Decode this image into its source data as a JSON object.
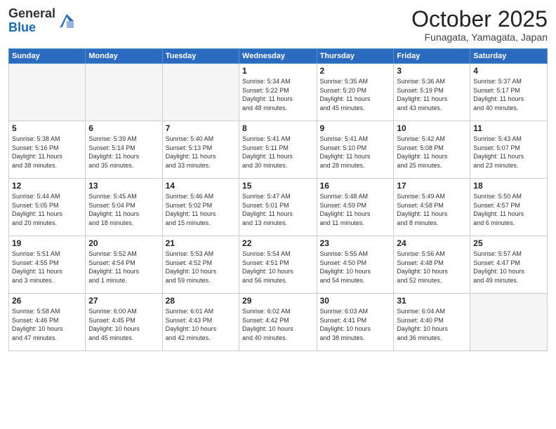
{
  "header": {
    "logo_general": "General",
    "logo_blue": "Blue",
    "month_title": "October 2025",
    "subtitle": "Funagata, Yamagata, Japan"
  },
  "weekdays": [
    "Sunday",
    "Monday",
    "Tuesday",
    "Wednesday",
    "Thursday",
    "Friday",
    "Saturday"
  ],
  "weeks": [
    [
      {
        "day": "",
        "info": ""
      },
      {
        "day": "",
        "info": ""
      },
      {
        "day": "",
        "info": ""
      },
      {
        "day": "1",
        "info": "Sunrise: 5:34 AM\nSunset: 5:22 PM\nDaylight: 11 hours\nand 48 minutes."
      },
      {
        "day": "2",
        "info": "Sunrise: 5:35 AM\nSunset: 5:20 PM\nDaylight: 11 hours\nand 45 minutes."
      },
      {
        "day": "3",
        "info": "Sunrise: 5:36 AM\nSunset: 5:19 PM\nDaylight: 11 hours\nand 43 minutes."
      },
      {
        "day": "4",
        "info": "Sunrise: 5:37 AM\nSunset: 5:17 PM\nDaylight: 11 hours\nand 40 minutes."
      }
    ],
    [
      {
        "day": "5",
        "info": "Sunrise: 5:38 AM\nSunset: 5:16 PM\nDaylight: 11 hours\nand 38 minutes."
      },
      {
        "day": "6",
        "info": "Sunrise: 5:39 AM\nSunset: 5:14 PM\nDaylight: 11 hours\nand 35 minutes."
      },
      {
        "day": "7",
        "info": "Sunrise: 5:40 AM\nSunset: 5:13 PM\nDaylight: 11 hours\nand 33 minutes."
      },
      {
        "day": "8",
        "info": "Sunrise: 5:41 AM\nSunset: 5:11 PM\nDaylight: 11 hours\nand 30 minutes."
      },
      {
        "day": "9",
        "info": "Sunrise: 5:41 AM\nSunset: 5:10 PM\nDaylight: 11 hours\nand 28 minutes."
      },
      {
        "day": "10",
        "info": "Sunrise: 5:42 AM\nSunset: 5:08 PM\nDaylight: 11 hours\nand 25 minutes."
      },
      {
        "day": "11",
        "info": "Sunrise: 5:43 AM\nSunset: 5:07 PM\nDaylight: 11 hours\nand 23 minutes."
      }
    ],
    [
      {
        "day": "12",
        "info": "Sunrise: 5:44 AM\nSunset: 5:05 PM\nDaylight: 11 hours\nand 20 minutes."
      },
      {
        "day": "13",
        "info": "Sunrise: 5:45 AM\nSunset: 5:04 PM\nDaylight: 11 hours\nand 18 minutes."
      },
      {
        "day": "14",
        "info": "Sunrise: 5:46 AM\nSunset: 5:02 PM\nDaylight: 11 hours\nand 15 minutes."
      },
      {
        "day": "15",
        "info": "Sunrise: 5:47 AM\nSunset: 5:01 PM\nDaylight: 11 hours\nand 13 minutes."
      },
      {
        "day": "16",
        "info": "Sunrise: 5:48 AM\nSunset: 4:59 PM\nDaylight: 11 hours\nand 11 minutes."
      },
      {
        "day": "17",
        "info": "Sunrise: 5:49 AM\nSunset: 4:58 PM\nDaylight: 11 hours\nand 8 minutes."
      },
      {
        "day": "18",
        "info": "Sunrise: 5:50 AM\nSunset: 4:57 PM\nDaylight: 11 hours\nand 6 minutes."
      }
    ],
    [
      {
        "day": "19",
        "info": "Sunrise: 5:51 AM\nSunset: 4:55 PM\nDaylight: 11 hours\nand 3 minutes."
      },
      {
        "day": "20",
        "info": "Sunrise: 5:52 AM\nSunset: 4:54 PM\nDaylight: 11 hours\nand 1 minute."
      },
      {
        "day": "21",
        "info": "Sunrise: 5:53 AM\nSunset: 4:52 PM\nDaylight: 10 hours\nand 59 minutes."
      },
      {
        "day": "22",
        "info": "Sunrise: 5:54 AM\nSunset: 4:51 PM\nDaylight: 10 hours\nand 56 minutes."
      },
      {
        "day": "23",
        "info": "Sunrise: 5:55 AM\nSunset: 4:50 PM\nDaylight: 10 hours\nand 54 minutes."
      },
      {
        "day": "24",
        "info": "Sunrise: 5:56 AM\nSunset: 4:48 PM\nDaylight: 10 hours\nand 52 minutes."
      },
      {
        "day": "25",
        "info": "Sunrise: 5:57 AM\nSunset: 4:47 PM\nDaylight: 10 hours\nand 49 minutes."
      }
    ],
    [
      {
        "day": "26",
        "info": "Sunrise: 5:58 AM\nSunset: 4:46 PM\nDaylight: 10 hours\nand 47 minutes."
      },
      {
        "day": "27",
        "info": "Sunrise: 6:00 AM\nSunset: 4:45 PM\nDaylight: 10 hours\nand 45 minutes."
      },
      {
        "day": "28",
        "info": "Sunrise: 6:01 AM\nSunset: 4:43 PM\nDaylight: 10 hours\nand 42 minutes."
      },
      {
        "day": "29",
        "info": "Sunrise: 6:02 AM\nSunset: 4:42 PM\nDaylight: 10 hours\nand 40 minutes."
      },
      {
        "day": "30",
        "info": "Sunrise: 6:03 AM\nSunset: 4:41 PM\nDaylight: 10 hours\nand 38 minutes."
      },
      {
        "day": "31",
        "info": "Sunrise: 6:04 AM\nSunset: 4:40 PM\nDaylight: 10 hours\nand 36 minutes."
      },
      {
        "day": "",
        "info": ""
      }
    ]
  ]
}
